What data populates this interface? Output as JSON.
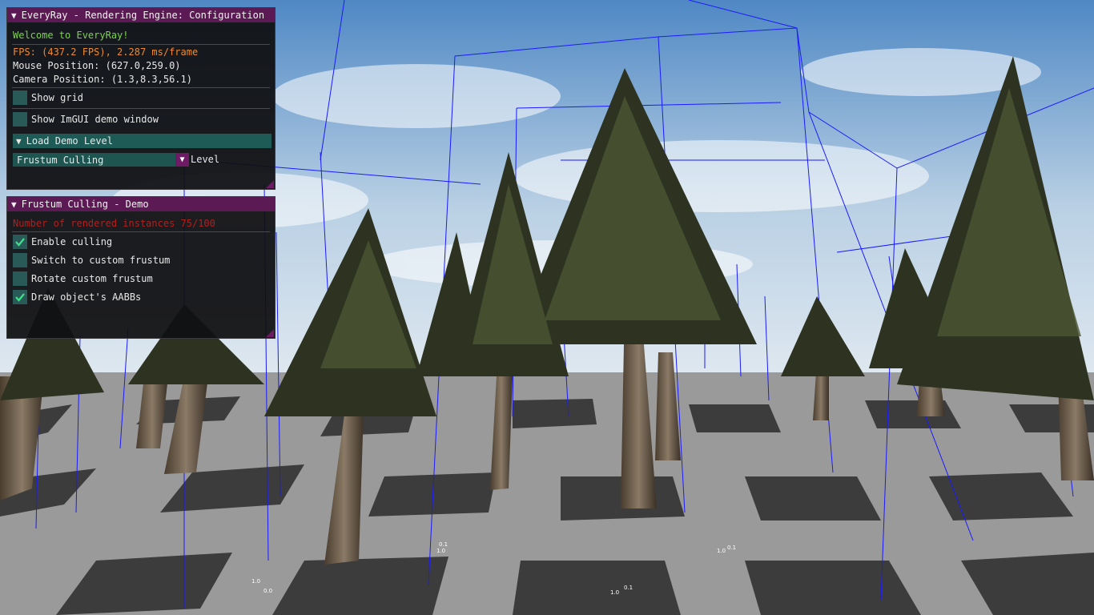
{
  "config_window": {
    "title": "EveryRay - Rendering Engine: Configuration",
    "welcome": "Welcome to EveryRay!",
    "fps": "FPS: (437.2 FPS), 2.287 ms/frame",
    "mouse": "Mouse Position: (627.0,259.0)",
    "camera": "Camera Position: (1.3,8.3,56.1)",
    "show_grid": {
      "label": "Show grid",
      "checked": false
    },
    "show_imgui_demo": {
      "label": "Show ImGUI demo window",
      "checked": false
    },
    "load_demo_level": "Load Demo Level",
    "level_combo": {
      "value": "Frustum Culling",
      "label": "Level"
    }
  },
  "culling_window": {
    "title": "Frustum Culling - Demo",
    "instances": "Number of rendered instances 75/100",
    "checkboxes": [
      {
        "label": "Enable culling",
        "checked": true
      },
      {
        "label": "Switch to custom frustum",
        "checked": false
      },
      {
        "label": "Rotate custom frustum",
        "checked": false
      },
      {
        "label": "Draw object's AABBs",
        "checked": true
      }
    ]
  },
  "colors": {
    "title_bar": "#5c1a54",
    "welcome_text": "#7cd44a",
    "fps_text": "#f08a2c",
    "instances_text": "#b02020",
    "checkbox_bg": "#2a5a58",
    "checkmark": "#40e08a",
    "aabb_lines": "#1a1aff"
  },
  "icons": [
    "collapse-arrow-icon",
    "checkmark-icon",
    "dropdown-arrow-icon",
    "resize-grip-icon"
  ]
}
